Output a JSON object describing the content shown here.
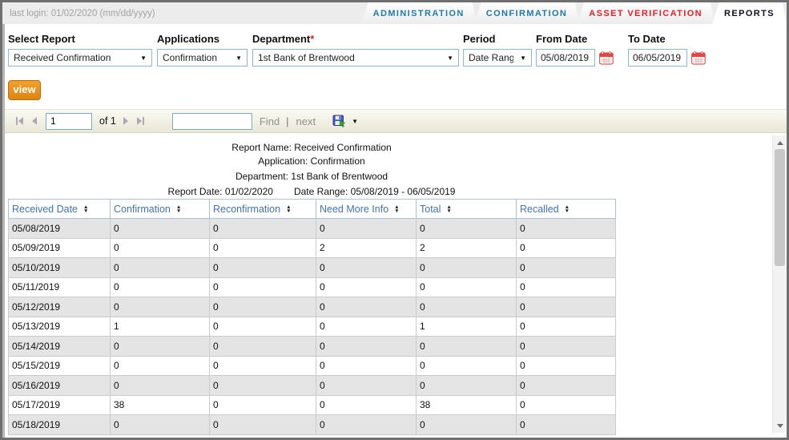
{
  "topbar": {
    "last_login": "last login: 01/02/2020 (mm/dd/yyyy)"
  },
  "tabs": [
    {
      "label": "ADMINISTRATION",
      "color": "#1f7aad",
      "active": false
    },
    {
      "label": "CONFIRMATION",
      "color": "#1f7aad",
      "active": false
    },
    {
      "label": "ASSET VERIFICATION",
      "color": "#ee1c24",
      "active": false
    },
    {
      "label": "REPORTS",
      "color": "#10101c",
      "active": true
    }
  ],
  "filters": {
    "select_report": {
      "label": "Select Report",
      "value": "Received Confirmation"
    },
    "applications": {
      "label": "Applications",
      "value": "Confirmation"
    },
    "department": {
      "label": "Department",
      "required_mark": "*",
      "value": "1st Bank of Brentwood"
    },
    "period": {
      "label": "Period",
      "value": "Date Range"
    },
    "from_date": {
      "label": "From Date",
      "value": "05/08/2019"
    },
    "to_date": {
      "label": "To Date",
      "value": "06/05/2019"
    }
  },
  "view_button_label": "view",
  "pager": {
    "page": "1",
    "of_label": "of 1",
    "search_value": "",
    "find_label": "Find",
    "separator": "|",
    "next_label": "next"
  },
  "report_header": {
    "line1": "Report Name: Received Confirmation",
    "line2": "Application: Confirmation",
    "line3": "Department: 1st Bank of Brentwood",
    "report_date": "Report Date: 01/02/2020",
    "date_range": "Date Range: 05/08/2019 - 06/05/2019"
  },
  "table": {
    "columns": [
      "Received Date",
      "Confirmation",
      "Reconfirmation",
      "Need More Info",
      "Total",
      "Recalled"
    ],
    "rows": [
      [
        "05/08/2019",
        "0",
        "0",
        "0",
        "0",
        "0"
      ],
      [
        "05/09/2019",
        "0",
        "0",
        "2",
        "2",
        "0"
      ],
      [
        "05/10/2019",
        "0",
        "0",
        "0",
        "0",
        "0"
      ],
      [
        "05/11/2019",
        "0",
        "0",
        "0",
        "0",
        "0"
      ],
      [
        "05/12/2019",
        "0",
        "0",
        "0",
        "0",
        "0"
      ],
      [
        "05/13/2019",
        "1",
        "0",
        "0",
        "1",
        "0"
      ],
      [
        "05/14/2019",
        "0",
        "0",
        "0",
        "0",
        "0"
      ],
      [
        "05/15/2019",
        "0",
        "0",
        "0",
        "0",
        "0"
      ],
      [
        "05/16/2019",
        "0",
        "0",
        "0",
        "0",
        "0"
      ],
      [
        "05/17/2019",
        "38",
        "0",
        "0",
        "38",
        "0"
      ],
      [
        "05/18/2019",
        "0",
        "0",
        "0",
        "0",
        "0"
      ]
    ]
  },
  "icons": {
    "select_arrow": "▼",
    "sort_asc": "▲",
    "sort_desc": "▼",
    "export_caret": "▼",
    "calendar_icon": "red-calendar-grid",
    "export_icon": "floppy-disk-green-arrow",
    "first_page_icon": "bar-triangle-left",
    "prev_page_icon": "triangle-left",
    "next_page_icon": "triangle-right",
    "last_page_icon": "triangle-right-bar",
    "scroll_up_icon": "triangle-up",
    "scroll_down_icon": "triangle-down"
  },
  "colors": {
    "view_button_orange": "#e08912",
    "tab_blue": "#1f7aad",
    "tab_red": "#ee1c24",
    "tab_active": "#10101c",
    "required_asterisk": "#e02020",
    "column_header_blue": "#4273b4",
    "alt_row_gray": "#e4e4e4"
  }
}
